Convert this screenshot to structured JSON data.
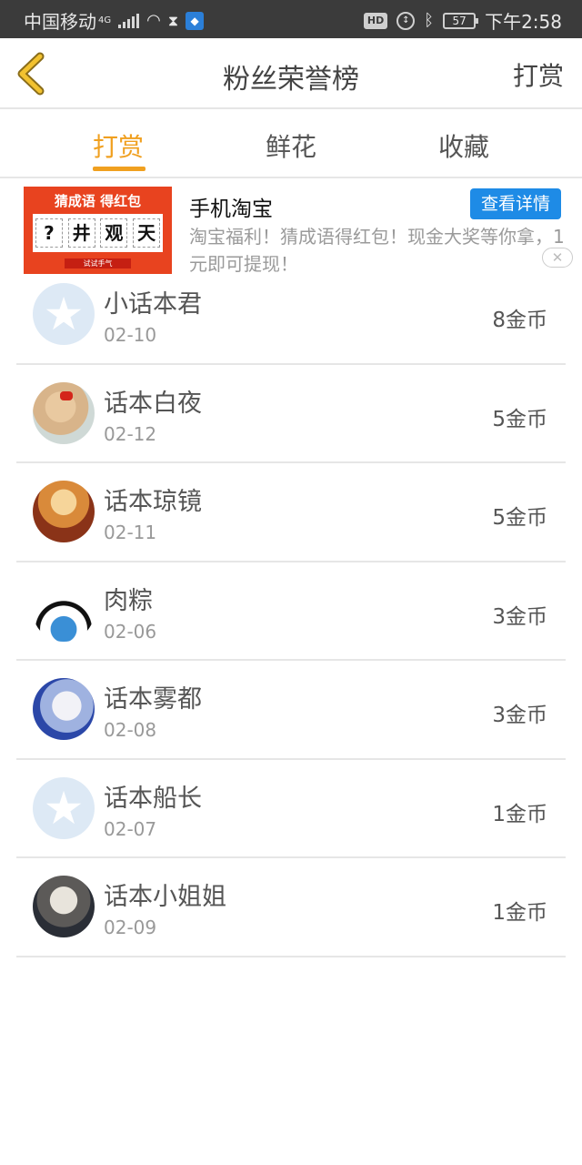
{
  "status_bar": {
    "carrier": "中国移动",
    "network": "4G",
    "time": "下午2:58",
    "hd_label": "HD",
    "battery": "57",
    "icons": [
      "signal-icon",
      "wifi-icon",
      "hourglass-icon",
      "shield-icon",
      "hd-icon",
      "data-saver-icon",
      "bluetooth-icon",
      "battery-icon"
    ]
  },
  "header": {
    "title": "粉丝荣誉榜",
    "right_action": "打赏",
    "back_icon": "chevron-left-icon",
    "accent_color": "#f0a020"
  },
  "tabs": [
    {
      "label": "打赏",
      "active": true
    },
    {
      "label": "鲜花",
      "active": false
    },
    {
      "label": "收藏",
      "active": false
    }
  ],
  "ad": {
    "image_title": "猜成语 得红包",
    "image_chars": [
      "?",
      "井",
      "观",
      "天"
    ],
    "image_button": "试试手气",
    "title": "手机淘宝",
    "cta": "查看详情",
    "description": "淘宝福利！猜成语得红包！现金大奖等你拿，1元即可提现！",
    "cta_color": "#1e8be6"
  },
  "fans": [
    {
      "name": "小话本君",
      "date": "02-10",
      "amount": "8金币",
      "avatar": "default"
    },
    {
      "name": "话本白夜",
      "date": "02-12",
      "amount": "5金币",
      "avatar": "photo"
    },
    {
      "name": "话本琼镜",
      "date": "02-11",
      "amount": "5金币",
      "avatar": "photo"
    },
    {
      "name": "肉粽",
      "date": "02-06",
      "amount": "3金币",
      "avatar": "photo"
    },
    {
      "name": "话本雾都",
      "date": "02-08",
      "amount": "3金币",
      "avatar": "photo"
    },
    {
      "name": "话本船长",
      "date": "02-07",
      "amount": "1金币",
      "avatar": "default"
    },
    {
      "name": "话本小姐姐",
      "date": "02-09",
      "amount": "1金币",
      "avatar": "photo"
    }
  ]
}
